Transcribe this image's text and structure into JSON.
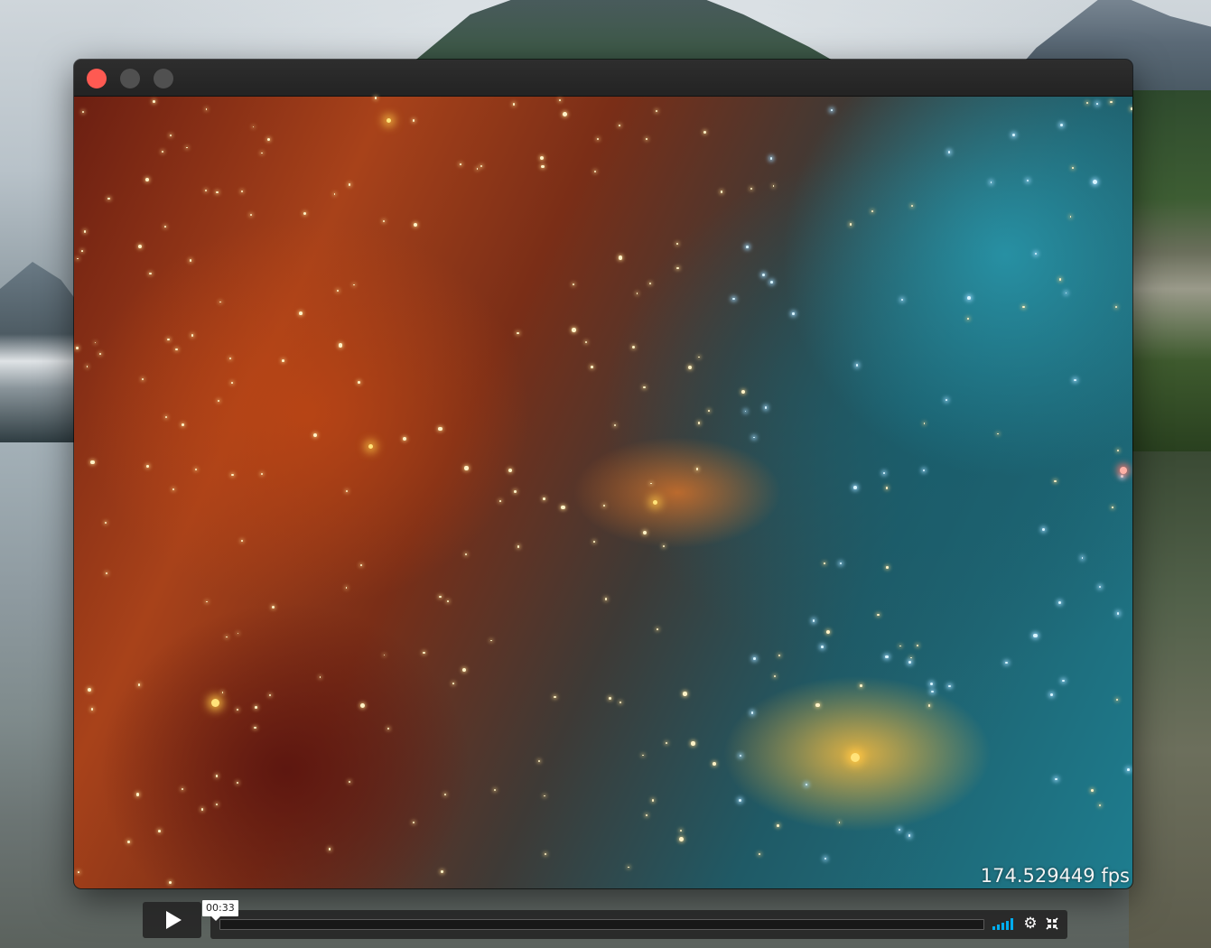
{
  "window": {
    "close_color": "#fe5a52",
    "inactive_color": "#505050",
    "titlebar_color": "#2a2a2a"
  },
  "video": {
    "fps_text": "174.529449 fps"
  },
  "controls": {
    "play_icon": "play-icon",
    "time_tooltip": "00:33",
    "progress": 0.0,
    "accent_color": "#00adef",
    "volume_icon": "volume-bars-icon",
    "settings_icon": "gear-icon",
    "fullscreen_icon": "fullscreen-icon"
  }
}
